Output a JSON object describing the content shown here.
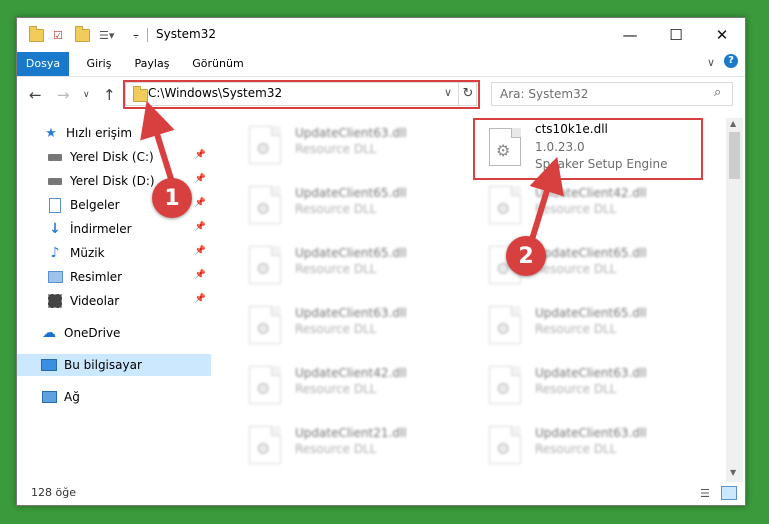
{
  "window": {
    "title": "System32",
    "min_label": "—",
    "max_label": "☐",
    "close_label": "✕"
  },
  "ribbon": {
    "tabs": [
      "Dosya",
      "Giriş",
      "Paylaş",
      "Görünüm"
    ]
  },
  "nav": {
    "address": "C:\\Windows\\System32",
    "search_placeholder": "Ara: System32"
  },
  "sidebar": {
    "items": [
      {
        "label": "Hızlı erişim",
        "icon": "star-icon"
      },
      {
        "label": "Yerel Disk (C:)",
        "icon": "drive-icon"
      },
      {
        "label": "Yerel Disk (D:)",
        "icon": "drive-icon"
      },
      {
        "label": "Belgeler",
        "icon": "documents-icon"
      },
      {
        "label": "İndirmeler",
        "icon": "download-icon"
      },
      {
        "label": "Müzik",
        "icon": "music-icon"
      },
      {
        "label": "Resimler",
        "icon": "pictures-icon"
      },
      {
        "label": "Videolar",
        "icon": "videos-icon"
      },
      {
        "label": "OneDrive",
        "icon": "cloud-icon"
      },
      {
        "label": "Bu bilgisayar",
        "icon": "computer-icon"
      },
      {
        "label": "Ağ",
        "icon": "network-icon"
      }
    ]
  },
  "files": {
    "left": [
      {
        "name": "UpdateClient63.dll",
        "type": "Resource DLL"
      },
      {
        "name": "UpdateClient65.dll",
        "type": "Resource DLL"
      },
      {
        "name": "UpdateClient65.dll",
        "type": "Resource DLL"
      },
      {
        "name": "UpdateClient63.dll",
        "type": "Resource DLL"
      },
      {
        "name": "UpdateClient42.dll",
        "type": "Resource DLL"
      },
      {
        "name": "UpdateClient21.dll",
        "type": "Resource DLL"
      }
    ],
    "highlighted": {
      "name": "cts10k1e.dll",
      "version": "1.0.23.0",
      "description": "Speaker Setup Engine"
    },
    "right": [
      {
        "name": "UpdateClient42.dll",
        "type": "Resource DLL"
      },
      {
        "name": "UpdateClient65.dll",
        "type": "Resource DLL"
      },
      {
        "name": "UpdateClient65.dll",
        "type": "Resource DLL"
      },
      {
        "name": "UpdateClient63.dll",
        "type": "Resource DLL"
      },
      {
        "name": "UpdateClient63.dll",
        "type": "Resource DLL"
      }
    ]
  },
  "status": {
    "count": "128 öğe"
  },
  "annotations": {
    "step1": "1",
    "step2": "2"
  },
  "colors": {
    "accent": "#1979ca",
    "marker": "#d84040",
    "selection": "#cce8ff"
  }
}
